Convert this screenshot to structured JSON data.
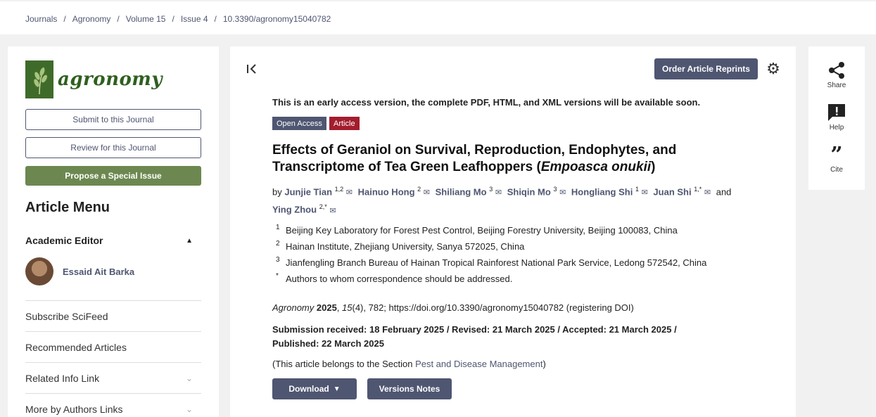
{
  "breadcrumb": [
    "Journals",
    "Agronomy",
    "Volume 15",
    "Issue 4",
    "10.3390/agronomy15040782"
  ],
  "sidebar": {
    "logo_text": "agronomy",
    "submit_label": "Submit to this Journal",
    "review_label": "Review for this Journal",
    "propose_label": "Propose a Special Issue",
    "menu_title": "Article Menu",
    "academic_editor_label": "Academic Editor",
    "editor_name": "Essaid Ait Barka",
    "menu_items": [
      "Subscribe SciFeed",
      "Recommended Articles",
      "Related Info Link",
      "More by Authors Links"
    ]
  },
  "main": {
    "reprint_label": "Order Article Reprints",
    "notice": "This is an early access version, the complete PDF, HTML, and XML versions will be available soon.",
    "badge_open_access": "Open Access",
    "badge_article": "Article",
    "title_main": "Effects of Geraniol on Survival, Reproduction, Endophytes, and Transcriptome of Tea Green Leafhoppers (",
    "title_italic": "Empoasca onukii",
    "title_end": ")",
    "by_label": "by",
    "and_label": "and",
    "authors": [
      {
        "name": "Junjie Tian",
        "sup": "1,2"
      },
      {
        "name": "Hainuo Hong",
        "sup": "2"
      },
      {
        "name": "Shiliang Mo",
        "sup": "3"
      },
      {
        "name": "Shiqin Mo",
        "sup": "3"
      },
      {
        "name": "Hongliang Shi",
        "sup": "1"
      },
      {
        "name": "Juan Shi",
        "sup": "1,*"
      },
      {
        "name": "Ying Zhou",
        "sup": "2,*"
      }
    ],
    "affiliations": [
      {
        "num": "1",
        "text": "Beijing Key Laboratory for Forest Pest Control, Beijing Forestry University, Beijing 100083, China"
      },
      {
        "num": "2",
        "text": "Hainan Institute, Zhejiang University, Sanya 572025, China"
      },
      {
        "num": "3",
        "text": "Jianfengling Branch Bureau of Hainan Tropical Rainforest National Park Service, Ledong 572542, China"
      },
      {
        "num": "*",
        "text": "Authors to whom correspondence should be addressed."
      }
    ],
    "citation": {
      "journal": "Agronomy",
      "year": "2025",
      "volume": "15",
      "rest": "(4), 782; https://doi.org/10.3390/agronomy15040782 (registering DOI)"
    },
    "dates": "Submission received: 18 February 2025 / Revised: 21 March 2025 / Accepted: 21 March 2025 / Published: 22 March 2025",
    "section_prefix": "(This article belongs to the Section ",
    "section_link": "Pest and Disease Management",
    "section_suffix": ")",
    "download_label": "Download",
    "versions_label": "Versions Notes"
  },
  "right_actions": {
    "share_label": "Share",
    "help_label": "Help",
    "cite_label": "Cite"
  }
}
